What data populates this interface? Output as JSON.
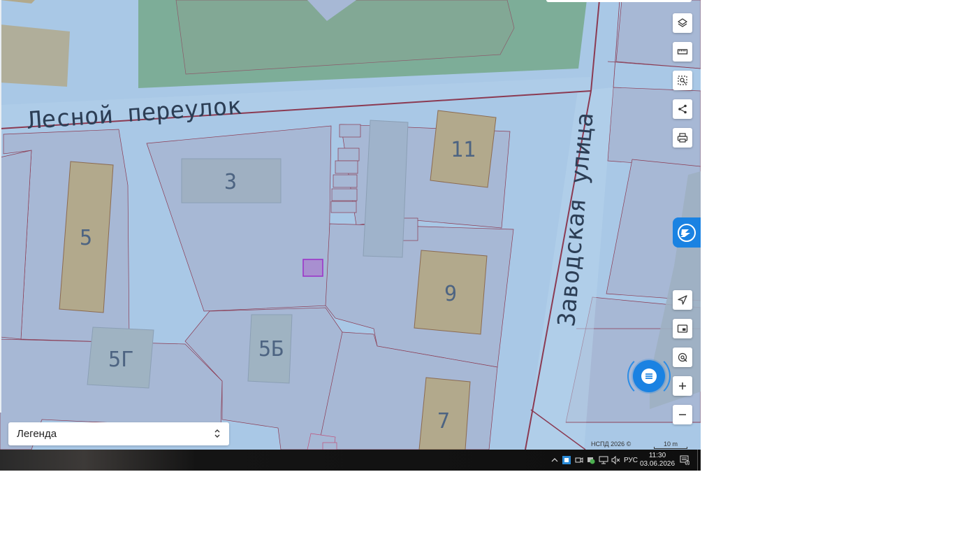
{
  "map": {
    "street_labels": [
      "Лесной переулок",
      "Заводская улица"
    ],
    "house_numbers": [
      "3",
      "5",
      "5Г",
      "5Б",
      "11",
      "9",
      "7"
    ],
    "attribution": "НСПД 2026 ©",
    "scale_label": "10 m",
    "colors": {
      "background": "#a9c8e6",
      "parcel_fill": "#a7b8d5",
      "building_fill": "#b2a98c",
      "green_area": "#7dad98",
      "boundary": "#8b3a52",
      "selected_parcel": "#a060c0",
      "accent": "#1a82e2"
    }
  },
  "toolbar": {
    "buttons": [
      {
        "name": "layers",
        "icon": "layers-icon"
      },
      {
        "name": "ruler",
        "icon": "ruler-icon"
      },
      {
        "name": "area-select",
        "icon": "area-select-icon"
      },
      {
        "name": "share",
        "icon": "share-icon"
      },
      {
        "name": "print",
        "icon": "printer-icon"
      },
      {
        "name": "locate",
        "icon": "navigation-arrow-icon"
      },
      {
        "name": "minimap",
        "icon": "picture-in-picture-icon"
      },
      {
        "name": "geolocation",
        "icon": "location-target-icon"
      },
      {
        "name": "zoom-in",
        "icon": "plus-icon"
      },
      {
        "name": "zoom-out",
        "icon": "minus-icon"
      }
    ]
  },
  "legend": {
    "label": "Легенда"
  },
  "taskbar": {
    "language": "РУС",
    "time": "11:30",
    "date": "03.06.2026",
    "notification_count": "1"
  }
}
